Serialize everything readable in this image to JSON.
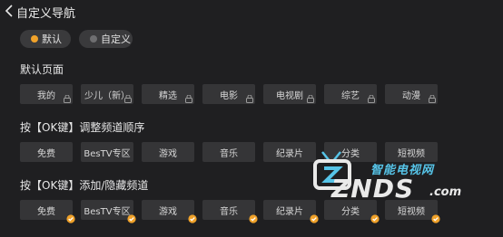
{
  "header": {
    "title": "自定义导航"
  },
  "mode_options": [
    {
      "label": "默认",
      "selected": true
    },
    {
      "label": "自定义",
      "selected": false
    }
  ],
  "sections": [
    {
      "title": "默认页面",
      "badge": "lock",
      "items": [
        "我的",
        "少儿（新）",
        "精选",
        "电影",
        "电视剧",
        "综艺",
        "动漫"
      ]
    },
    {
      "title": "按【OK键】调整频道顺序",
      "badge": "none",
      "items": [
        "免费",
        "BesTV专区",
        "游戏",
        "音乐",
        "纪录片",
        "分类",
        "短视频"
      ]
    },
    {
      "title": "按【OK键】添加/隐藏频道",
      "badge": "check",
      "items": [
        "免费",
        "BesTV专区",
        "游戏",
        "音乐",
        "纪录片",
        "分类",
        "短视频"
      ]
    }
  ],
  "watermark": {
    "cn_text": "智能电视网",
    "main_text": "ZNDS",
    "suffix": ".com"
  },
  "colors": {
    "accent": "#f0a22a",
    "background": "#1f1f21",
    "tile": "#353537",
    "watermark_blue": "#56c4e8"
  }
}
